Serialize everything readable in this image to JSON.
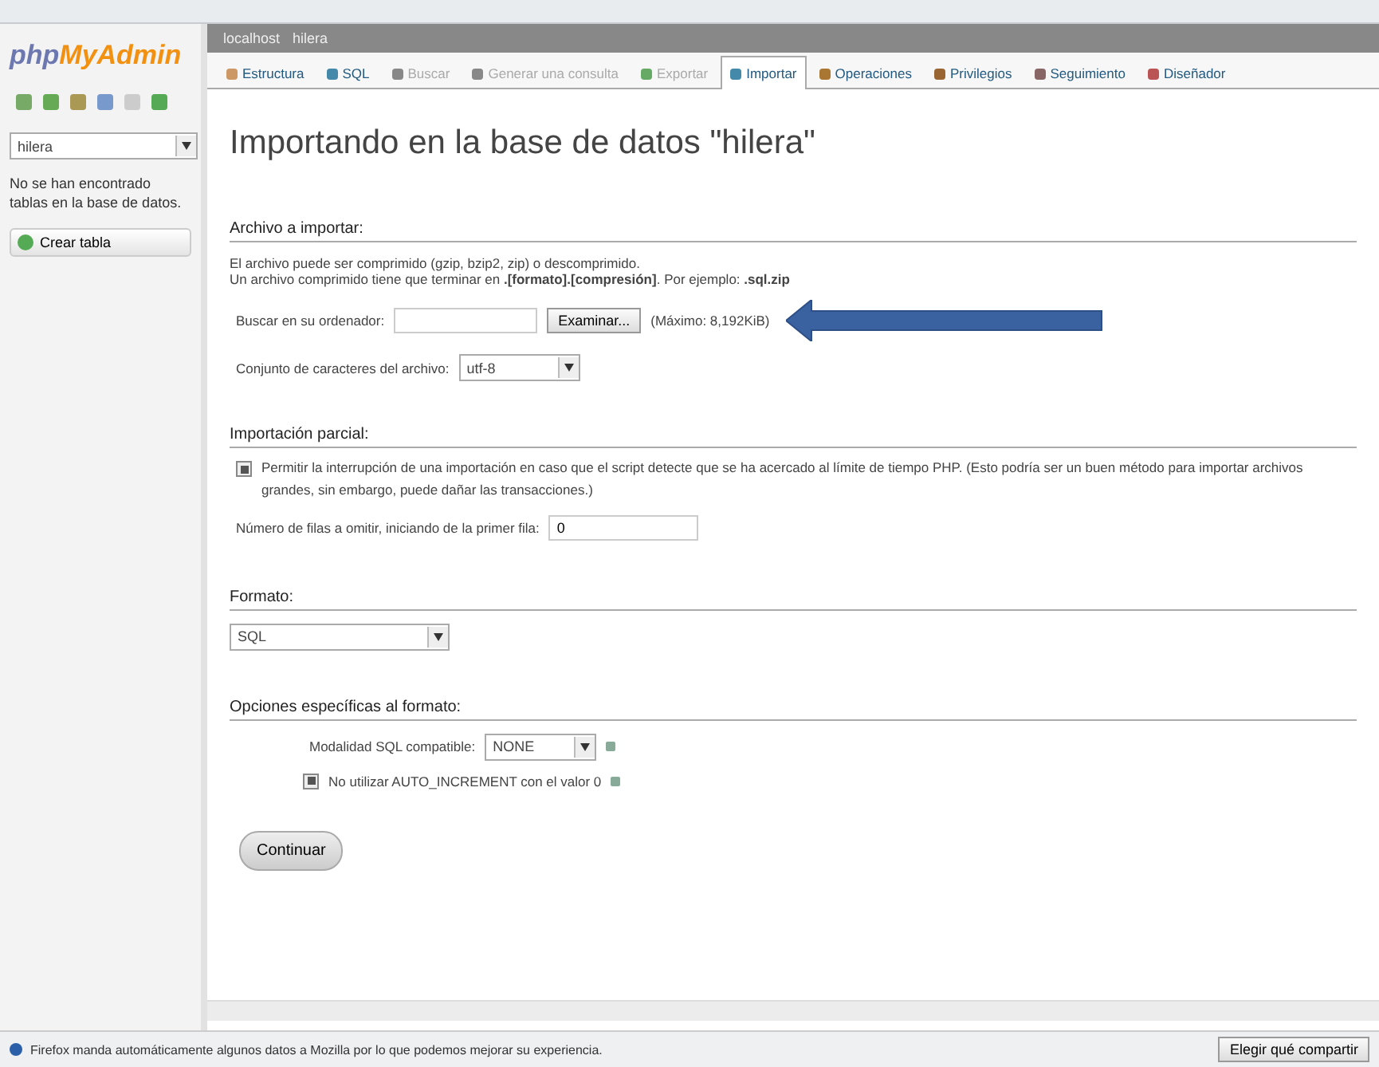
{
  "sidebar": {
    "logo": {
      "first": "php",
      "second": "MyAdmin"
    },
    "database_select": {
      "value": "hilera"
    },
    "message": "No se han encontrado tablas en la base de datos.",
    "create_button": "Crear tabla"
  },
  "breadcrumb": [
    "localhost",
    "hilera"
  ],
  "tabs": [
    {
      "label": "Estructura",
      "selected": false,
      "disabled": false
    },
    {
      "label": "SQL",
      "selected": false,
      "disabled": false
    },
    {
      "label": "Buscar",
      "selected": false,
      "disabled": true
    },
    {
      "label": "Generar una consulta",
      "selected": false,
      "disabled": true
    },
    {
      "label": "Exportar",
      "selected": false,
      "disabled": true
    },
    {
      "label": "Importar",
      "selected": true,
      "disabled": false
    },
    {
      "label": "Operaciones",
      "selected": false,
      "disabled": false
    },
    {
      "label": "Privilegios",
      "selected": false,
      "disabled": false
    },
    {
      "label": "Seguimiento",
      "selected": false,
      "disabled": false
    },
    {
      "label": "Diseñador",
      "selected": false,
      "disabled": false
    }
  ],
  "title": "Importando en la base de datos \"hilera\"",
  "file_section": {
    "legend": "Archivo a importar:",
    "notes": [
      "El archivo puede ser comprimido (gzip, bzip2, zip) o descomprimido.",
      "Un archivo comprimido tiene que terminar en **.[formato].[compresión]**. Por ejemplo: **.sql.zip**"
    ],
    "browse_label": "Buscar en su ordenador:",
    "browse_button": "Examinar...",
    "max_size": "(Máximo: 8,192KiB)",
    "charset_label": "Conjunto de caracteres del archivo:",
    "charset": "utf-8"
  },
  "partial_section": {
    "legend": "Importación parcial:",
    "allow_interrupt": {
      "checked": true,
      "label": "Permitir la interrupción de una importación en caso que el script detecte que se ha acercado al límite de tiempo PHP. (Esto podría ser un buen método para importar archivos grandes, sin embargo, puede dañar las transacciones.)"
    },
    "skip_label": "Número de filas a omitir, iniciando de la primer fila:",
    "skip_value": "0"
  },
  "format_section": {
    "legend": "Formato:",
    "format": "SQL"
  },
  "options_section": {
    "legend": "Opciones específicas al formato:",
    "compat_label": "Modalidad SQL compatible:",
    "compat_value": "NONE",
    "no_auto_value": {
      "checked": true,
      "label": "No utilizar AUTO_INCREMENT con el valor 0"
    }
  },
  "submit_button": "Continuar",
  "notification_bar": {
    "message": "Firefox manda automáticamente algunos datos a Mozilla por lo que podemos mejorar su experiencia.",
    "button": "Elegir qué compartir"
  }
}
